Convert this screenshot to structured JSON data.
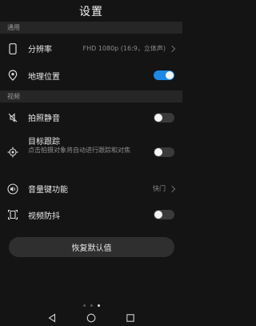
{
  "header": {
    "title": "设置"
  },
  "sections": {
    "general": "通用",
    "video": "视频"
  },
  "rows": {
    "resolution": {
      "label": "分辨率",
      "value": "FHD 1080p (16:9，立体声)",
      "icon": "phone-icon"
    },
    "location": {
      "label": "地理位置",
      "icon": "location-pin-icon",
      "enabled": true
    },
    "mute_shutter": {
      "label": "拍照静音",
      "icon": "mute-icon",
      "enabled": false
    },
    "tracking": {
      "label": "目标跟踪",
      "desc": "点击拍摄对象将自动进行跟踪和对焦",
      "icon": "target-icon",
      "enabled": false
    },
    "volume_key": {
      "label": "音量键功能",
      "value": "快门",
      "icon": "volume-icon"
    },
    "stabilization": {
      "label": "视频防抖",
      "icon": "stabilize-icon",
      "enabled": false
    }
  },
  "reset": {
    "label": "恢复默认值"
  },
  "colors": {
    "accent": "#1e88e5",
    "background": "#141414",
    "section": "#262626"
  },
  "nav": {
    "icons": [
      "back-icon",
      "home-icon",
      "recents-icon"
    ]
  }
}
